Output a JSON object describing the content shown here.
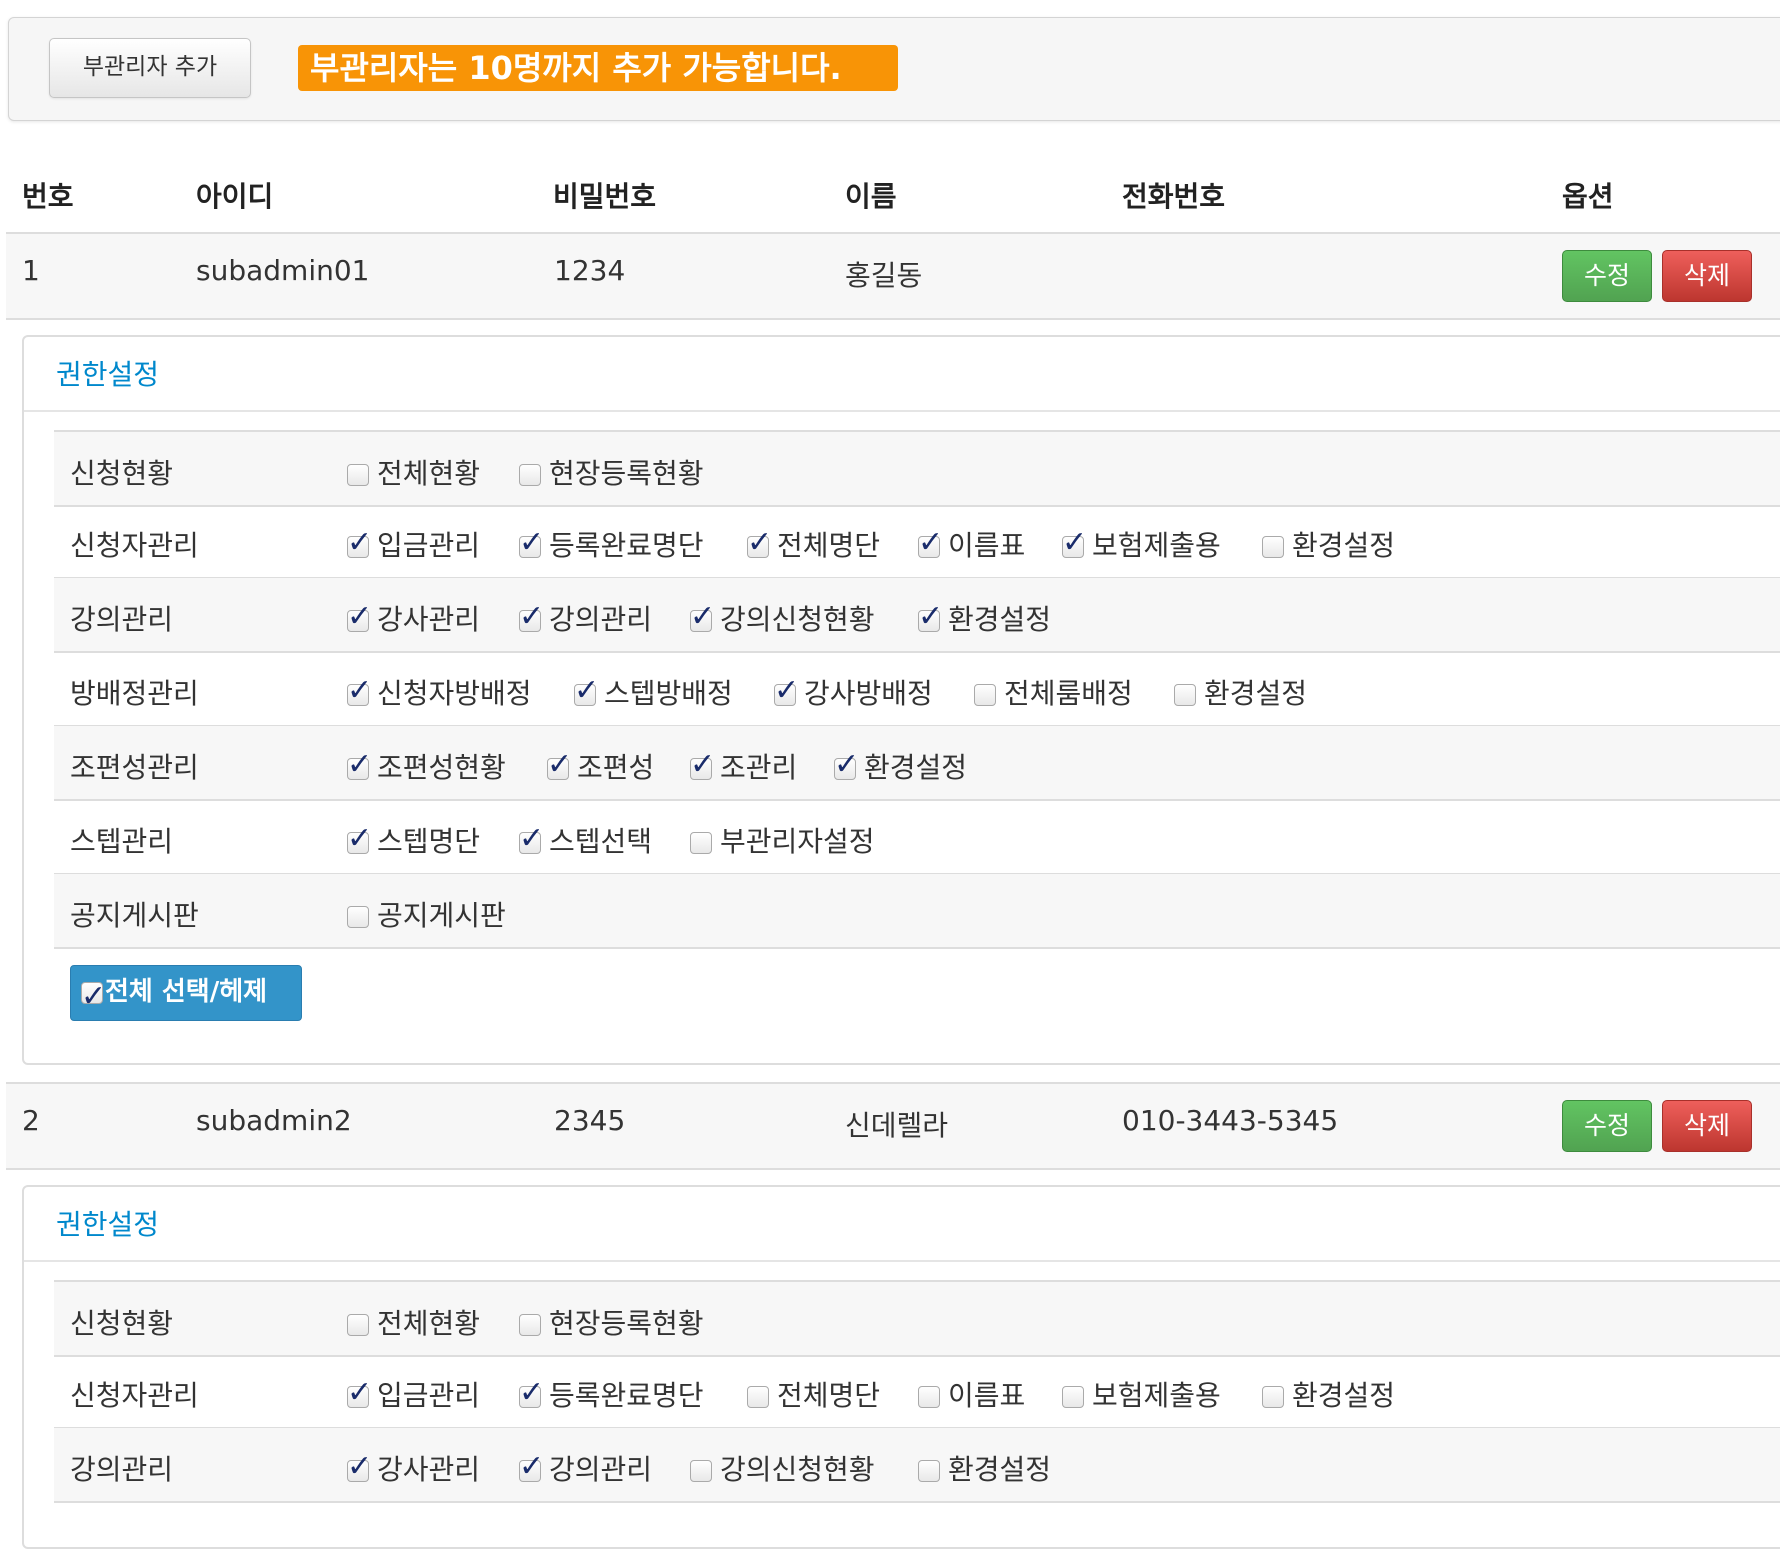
{
  "toolbar": {
    "add_label": "부관리자 추가",
    "notice": "부관리자는 10명까지 추가 가능합니다."
  },
  "headers": [
    "번호",
    "아이디",
    "비밀번호",
    "이름",
    "전화번호",
    "옵션"
  ],
  "edit_label": "수정",
  "delete_label": "삭제",
  "perm_title": "권한설정",
  "select_all_label": "전체 선택/헤제",
  "users": [
    {
      "no": "1",
      "id": "subadmin01",
      "password": "1234",
      "name": "홍길동",
      "phone": "",
      "perms": [
        {
          "label": "신청현황",
          "options": [
            {
              "t": "전체현황",
              "c": false
            },
            {
              "t": "현장등록현황",
              "c": false
            }
          ]
        },
        {
          "label": "신청자관리",
          "options": [
            {
              "t": "입금관리",
              "c": true
            },
            {
              "t": "등록완료명단",
              "c": true
            },
            {
              "t": "전체명단",
              "c": true
            },
            {
              "t": "이름표",
              "c": true
            },
            {
              "t": "보험제출용",
              "c": true
            },
            {
              "t": "환경설정",
              "c": false
            }
          ]
        },
        {
          "label": "강의관리",
          "options": [
            {
              "t": "강사관리",
              "c": true
            },
            {
              "t": "강의관리",
              "c": true
            },
            {
              "t": "강의신청현황",
              "c": true
            },
            {
              "t": "환경설정",
              "c": true
            }
          ]
        },
        {
          "label": "방배정관리",
          "options": [
            {
              "t": "신청자방배정",
              "c": true
            },
            {
              "t": "스텝방배정",
              "c": true
            },
            {
              "t": "강사방배정",
              "c": true
            },
            {
              "t": "전체룸배정",
              "c": false
            },
            {
              "t": "환경설정",
              "c": false
            }
          ]
        },
        {
          "label": "조편성관리",
          "options": [
            {
              "t": "조편성현황",
              "c": true
            },
            {
              "t": "조편성",
              "c": true
            },
            {
              "t": "조관리",
              "c": true
            },
            {
              "t": "환경설정",
              "c": true
            }
          ]
        },
        {
          "label": "스텝관리",
          "options": [
            {
              "t": "스텝명단",
              "c": true
            },
            {
              "t": "스텝선택",
              "c": true
            },
            {
              "t": "부관리자설정",
              "c": false
            }
          ]
        },
        {
          "label": "공지게시판",
          "options": [
            {
              "t": "공지게시판",
              "c": false
            }
          ]
        }
      ]
    },
    {
      "no": "2",
      "id": "subadmin2",
      "password": "2345",
      "name": "신데렐라",
      "phone": "010-3443-5345",
      "perms": [
        {
          "label": "신청현황",
          "options": [
            {
              "t": "전체현황",
              "c": false
            },
            {
              "t": "현장등록현황",
              "c": false
            }
          ]
        },
        {
          "label": "신청자관리",
          "options": [
            {
              "t": "입금관리",
              "c": true
            },
            {
              "t": "등록완료명단",
              "c": true
            },
            {
              "t": "전체명단",
              "c": false
            },
            {
              "t": "이름표",
              "c": false
            },
            {
              "t": "보험제출용",
              "c": false
            },
            {
              "t": "환경설정",
              "c": false
            }
          ]
        },
        {
          "label": "강의관리",
          "options": [
            {
              "t": "강사관리",
              "c": true
            },
            {
              "t": "강의관리",
              "c": true
            },
            {
              "t": "강의신청현황",
              "c": false
            },
            {
              "t": "환경설정",
              "c": false
            }
          ]
        }
      ]
    }
  ]
}
